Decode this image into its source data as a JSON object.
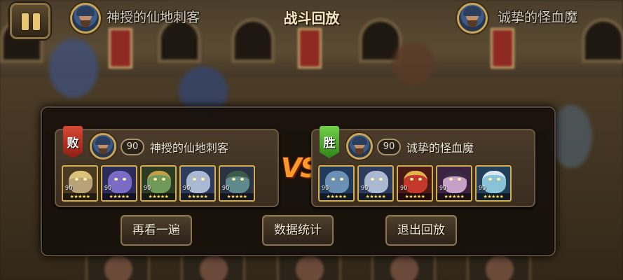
{
  "header": {
    "pause_icon": "pause-icon",
    "title": "战斗回放",
    "left_player": "神授的仙地刺客",
    "right_player": "诚挚的怪血魔"
  },
  "result": {
    "vs_label": "VS",
    "left_team": {
      "result_label": "败",
      "result_color": "#c2321f",
      "level": "90",
      "name": "神授的仙地刺客",
      "heroes": [
        {
          "icon": "straw-hat-warrior",
          "level": "90",
          "stars": "★★★★★"
        },
        {
          "icon": "purple-elf-mage",
          "level": "90",
          "stars": "★★★★★"
        },
        {
          "icon": "green-armored-orc",
          "level": "90",
          "stars": "★★★★★"
        },
        {
          "icon": "white-wolf-beast",
          "level": "90",
          "stars": "★★★★★"
        },
        {
          "icon": "medusa-sorceress",
          "level": "90",
          "stars": "★★★★★"
        }
      ]
    },
    "right_team": {
      "result_label": "胜",
      "result_color": "#3f9a22",
      "level": "90",
      "name": "诚挚的怪血魔",
      "heroes": [
        {
          "icon": "blue-wolf-warrior",
          "level": "90",
          "stars": "★★★★★"
        },
        {
          "icon": "white-wolf-beast",
          "level": "90",
          "stars": "★★★★★"
        },
        {
          "icon": "red-armored-knight",
          "level": "90",
          "stars": "★★★★★"
        },
        {
          "icon": "dark-elf-maiden",
          "level": "90",
          "stars": "★★★★★"
        },
        {
          "icon": "frost-elf-lord",
          "level": "90",
          "stars": "★★★★★"
        }
      ]
    },
    "buttons": {
      "replay": "再看一遍",
      "stats": "数据统计",
      "exit": "退出回放"
    }
  }
}
